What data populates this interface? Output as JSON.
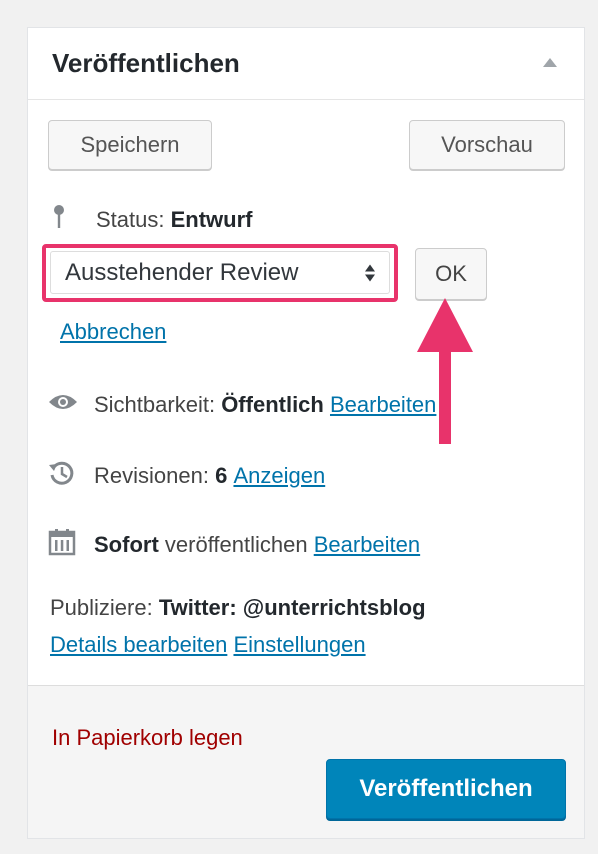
{
  "panel": {
    "title": "Veröffentlichen"
  },
  "actions": {
    "save_label": "Speichern",
    "preview_label": "Vorschau"
  },
  "status": {
    "label": "Status:",
    "value": "Entwurf",
    "select_value": "Ausstehender Review",
    "ok_label": "OK",
    "cancel_label": "Abbrechen"
  },
  "visibility": {
    "label": "Sichtbarkeit:",
    "value": "Öffentlich",
    "edit_label": "Bearbeiten"
  },
  "revisions": {
    "label": "Revisionen:",
    "count": "6",
    "show_label": "Anzeigen"
  },
  "schedule": {
    "value": "Sofort",
    "label": "veröffentlichen",
    "edit_label": "Bearbeiten"
  },
  "publicize": {
    "label": "Publiziere:",
    "value": "Twitter: @unterrichtsblog",
    "details_label": "Details bearbeiten",
    "settings_label": "Einstellungen"
  },
  "footer": {
    "trash_label": "In Papierkorb legen",
    "publish_label": "Veröffentlichen"
  },
  "icons": {
    "status": "pin-icon",
    "visibility": "eye-icon",
    "revisions": "history-icon",
    "schedule": "calendar-icon"
  },
  "colors": {
    "accent": "#0085ba",
    "link": "#0073aa",
    "highlight": "#e8336b",
    "trash": "#a00000"
  }
}
